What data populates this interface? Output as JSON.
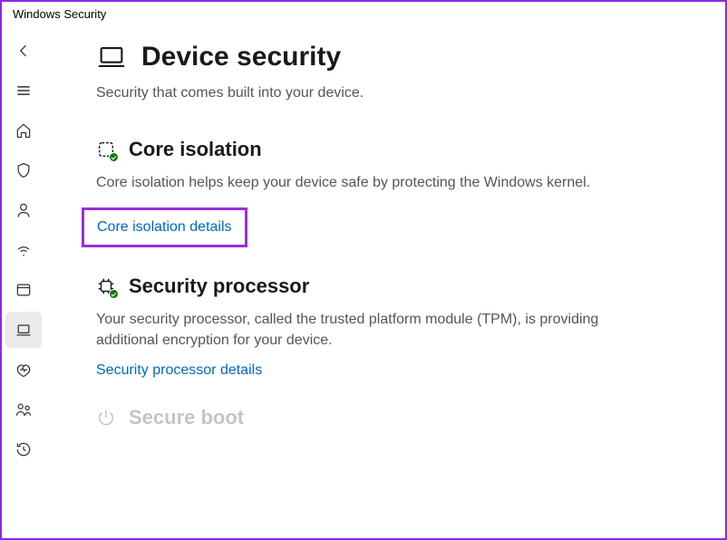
{
  "window": {
    "title": "Windows Security"
  },
  "page": {
    "title": "Device security",
    "subtitle": "Security that comes built into your device."
  },
  "sections": {
    "core": {
      "title": "Core isolation",
      "desc": "Core isolation helps keep your device safe by protecting the Windows kernel.",
      "link": "Core isolation details"
    },
    "tpm": {
      "title": "Security processor",
      "desc": "Your security processor, called the trusted platform module (TPM), is providing additional encryption for your device.",
      "link": "Security processor details"
    },
    "secureboot": {
      "title": "Secure boot"
    }
  },
  "nav": {
    "back": "back",
    "menu": "menu",
    "home": "home",
    "virus": "virus-threat",
    "account": "account-protection",
    "firewall": "firewall-network",
    "app": "app-browser-control",
    "device": "device-security",
    "perf": "device-performance",
    "family": "family-options",
    "history": "protection-history"
  }
}
